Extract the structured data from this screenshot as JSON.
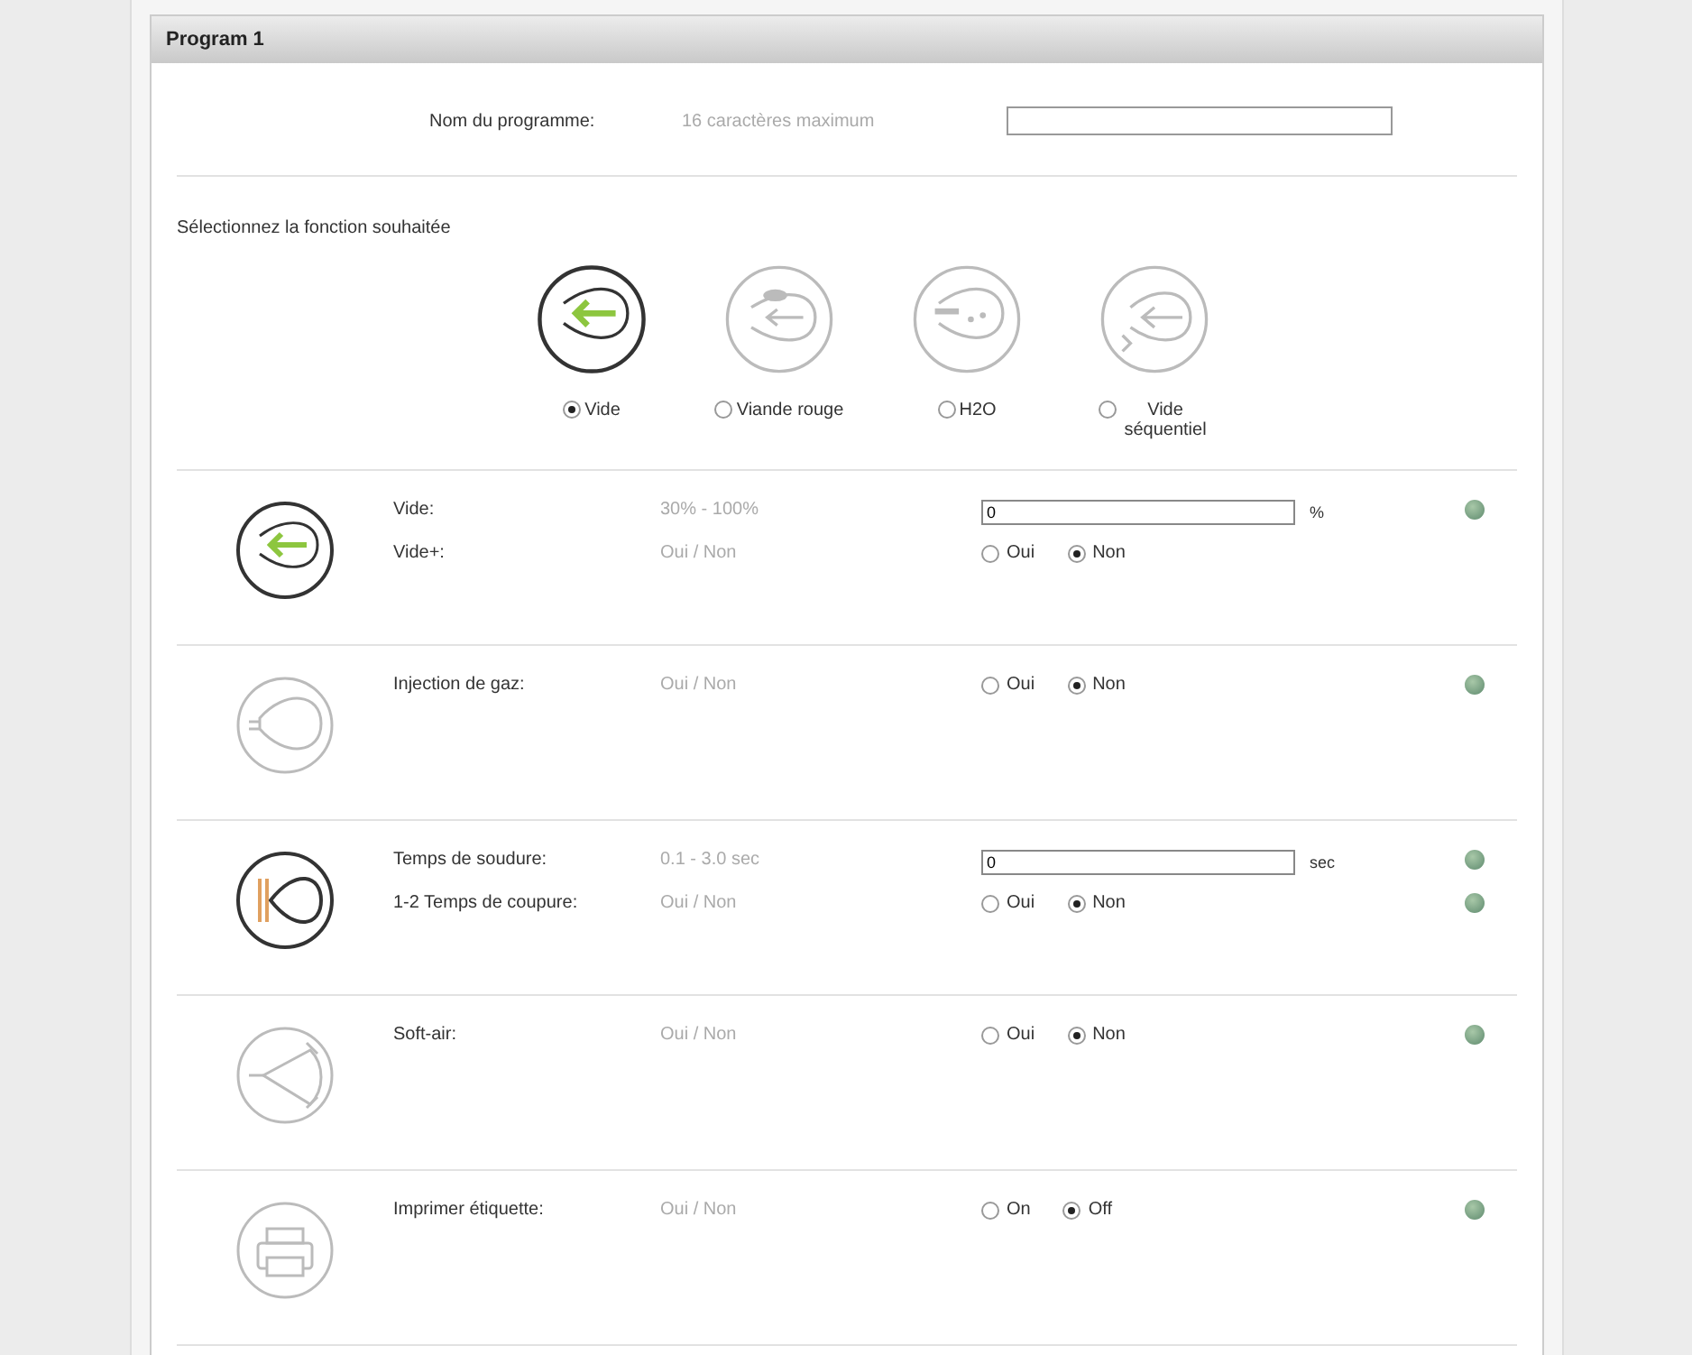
{
  "panel": {
    "title": "Program 1"
  },
  "name_field": {
    "label": "Nom du programme:",
    "hint": "16 caractères maximum"
  },
  "function_select": {
    "label": "Sélectionnez la fonction souhaitée",
    "options": [
      {
        "kind": "vacuum",
        "label": "Vide",
        "selected": true
      },
      {
        "kind": "meat",
        "label": "Viande rouge",
        "selected": false
      },
      {
        "kind": "water",
        "label": "H2O",
        "selected": false
      },
      {
        "kind": "sequential",
        "label": "Vide séquentiel",
        "selected": false
      }
    ]
  },
  "sections": [
    {
      "kind": "vacuum",
      "lines": [
        {
          "label": "Vide:",
          "hint": "30% - 100%",
          "control": {
            "kind": "input",
            "value": "0",
            "unit": "%"
          },
          "help": true
        },
        {
          "label": "Vide+:",
          "hint": "Oui / Non",
          "control": {
            "kind": "radio",
            "options": [
              {
                "label": "Oui",
                "selected": false
              },
              {
                "label": "Non",
                "selected": true
              }
            ]
          },
          "help": false
        }
      ]
    },
    {
      "kind": "gas",
      "lines": [
        {
          "label": "Injection de gaz:",
          "hint": "Oui / Non",
          "control": {
            "kind": "radio",
            "options": [
              {
                "label": "Oui",
                "selected": false
              },
              {
                "label": "Non",
                "selected": true
              }
            ]
          },
          "help": true
        }
      ]
    },
    {
      "kind": "seal",
      "lines": [
        {
          "label": "Temps de soudure:",
          "hint": "0.1 - 3.0 sec",
          "control": {
            "kind": "input",
            "value": "0",
            "unit": "sec"
          },
          "help": true
        },
        {
          "label": "1-2 Temps de coupure:",
          "hint": "Oui / Non",
          "control": {
            "kind": "radio",
            "options": [
              {
                "label": "Oui",
                "selected": false
              },
              {
                "label": "Non",
                "selected": true
              }
            ]
          },
          "help": true
        }
      ]
    },
    {
      "kind": "softair",
      "lines": [
        {
          "label": "Soft-air:",
          "hint": "Oui / Non",
          "control": {
            "kind": "radio",
            "options": [
              {
                "label": "Oui",
                "selected": false
              },
              {
                "label": "Non",
                "selected": true
              }
            ]
          },
          "help": true
        }
      ]
    },
    {
      "kind": "printer",
      "lines": [
        {
          "label": "Imprimer étiquette:",
          "hint": "Oui / Non",
          "control": {
            "kind": "radio",
            "options": [
              {
                "label": "On",
                "selected": false
              },
              {
                "label": "Off",
                "selected": true
              }
            ]
          },
          "help": true
        }
      ]
    }
  ]
}
